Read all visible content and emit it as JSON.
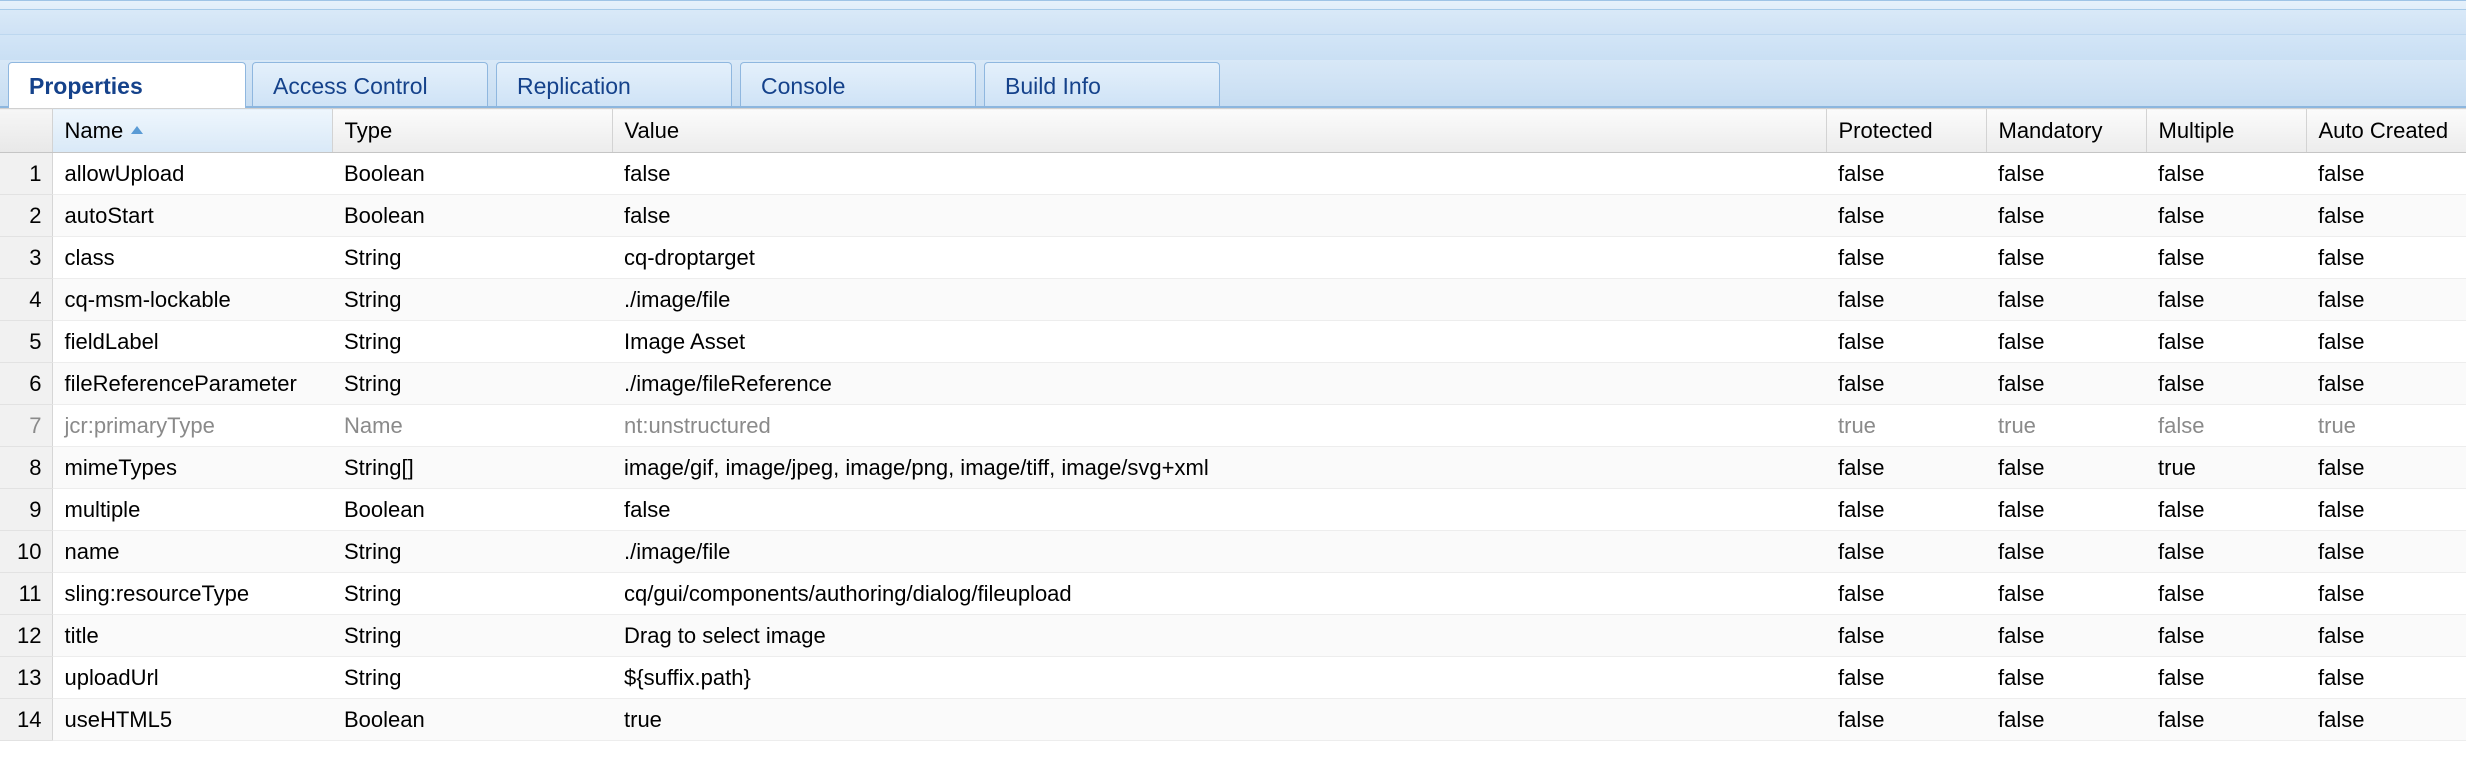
{
  "tabs": [
    {
      "label": "Properties",
      "active": true
    },
    {
      "label": "Access Control",
      "active": false
    },
    {
      "label": "Replication",
      "active": false
    },
    {
      "label": "Console",
      "active": false
    },
    {
      "label": "Build Info",
      "active": false
    }
  ],
  "table": {
    "columns": [
      "Name",
      "Type",
      "Value",
      "Protected",
      "Mandatory",
      "Multiple",
      "Auto Created"
    ],
    "sorted_column": "Name",
    "sort_direction": "ascending",
    "rows": [
      {
        "num": "1",
        "name": "allowUpload",
        "type": "Boolean",
        "value": "false",
        "protected": "false",
        "mandatory": "false",
        "multiple": "false",
        "auto_created": "false"
      },
      {
        "num": "2",
        "name": "autoStart",
        "type": "Boolean",
        "value": "false",
        "protected": "false",
        "mandatory": "false",
        "multiple": "false",
        "auto_created": "false"
      },
      {
        "num": "3",
        "name": "class",
        "type": "String",
        "value": "cq-droptarget",
        "protected": "false",
        "mandatory": "false",
        "multiple": "false",
        "auto_created": "false"
      },
      {
        "num": "4",
        "name": "cq-msm-lockable",
        "type": "String",
        "value": "./image/file",
        "protected": "false",
        "mandatory": "false",
        "multiple": "false",
        "auto_created": "false"
      },
      {
        "num": "5",
        "name": "fieldLabel",
        "type": "String",
        "value": "Image Asset",
        "protected": "false",
        "mandatory": "false",
        "multiple": "false",
        "auto_created": "false"
      },
      {
        "num": "6",
        "name": "fileReferenceParameter",
        "type": "String",
        "value": "./image/fileReference",
        "protected": "false",
        "mandatory": "false",
        "multiple": "false",
        "auto_created": "false"
      },
      {
        "num": "7",
        "name": "jcr:primaryType",
        "type": "Name",
        "value": "nt:unstructured",
        "protected": "true",
        "mandatory": "true",
        "multiple": "false",
        "auto_created": "true"
      },
      {
        "num": "8",
        "name": "mimeTypes",
        "type": "String[]",
        "value": "image/gif, image/jpeg, image/png, image/tiff, image/svg+xml",
        "protected": "false",
        "mandatory": "false",
        "multiple": "true",
        "auto_created": "false"
      },
      {
        "num": "9",
        "name": "multiple",
        "type": "Boolean",
        "value": "false",
        "protected": "false",
        "mandatory": "false",
        "multiple": "false",
        "auto_created": "false"
      },
      {
        "num": "10",
        "name": "name",
        "type": "String",
        "value": "./image/file",
        "protected": "false",
        "mandatory": "false",
        "multiple": "false",
        "auto_created": "false"
      },
      {
        "num": "11",
        "name": "sling:resourceType",
        "type": "String",
        "value": "cq/gui/components/authoring/dialog/fileupload",
        "protected": "false",
        "mandatory": "false",
        "multiple": "false",
        "auto_created": "false"
      },
      {
        "num": "12",
        "name": "title",
        "type": "String",
        "value": "Drag to select image",
        "protected": "false",
        "mandatory": "false",
        "multiple": "false",
        "auto_created": "false"
      },
      {
        "num": "13",
        "name": "uploadUrl",
        "type": "String",
        "value": "${suffix.path}",
        "protected": "false",
        "mandatory": "false",
        "multiple": "false",
        "auto_created": "false"
      },
      {
        "num": "14",
        "name": "useHTML5",
        "type": "Boolean",
        "value": "true",
        "protected": "false",
        "mandatory": "false",
        "multiple": "false",
        "auto_created": "false"
      }
    ]
  },
  "colors": {
    "tab_text": "#15428b",
    "header_border": "#8cb6de",
    "dim_text": "#8a8a8a"
  }
}
